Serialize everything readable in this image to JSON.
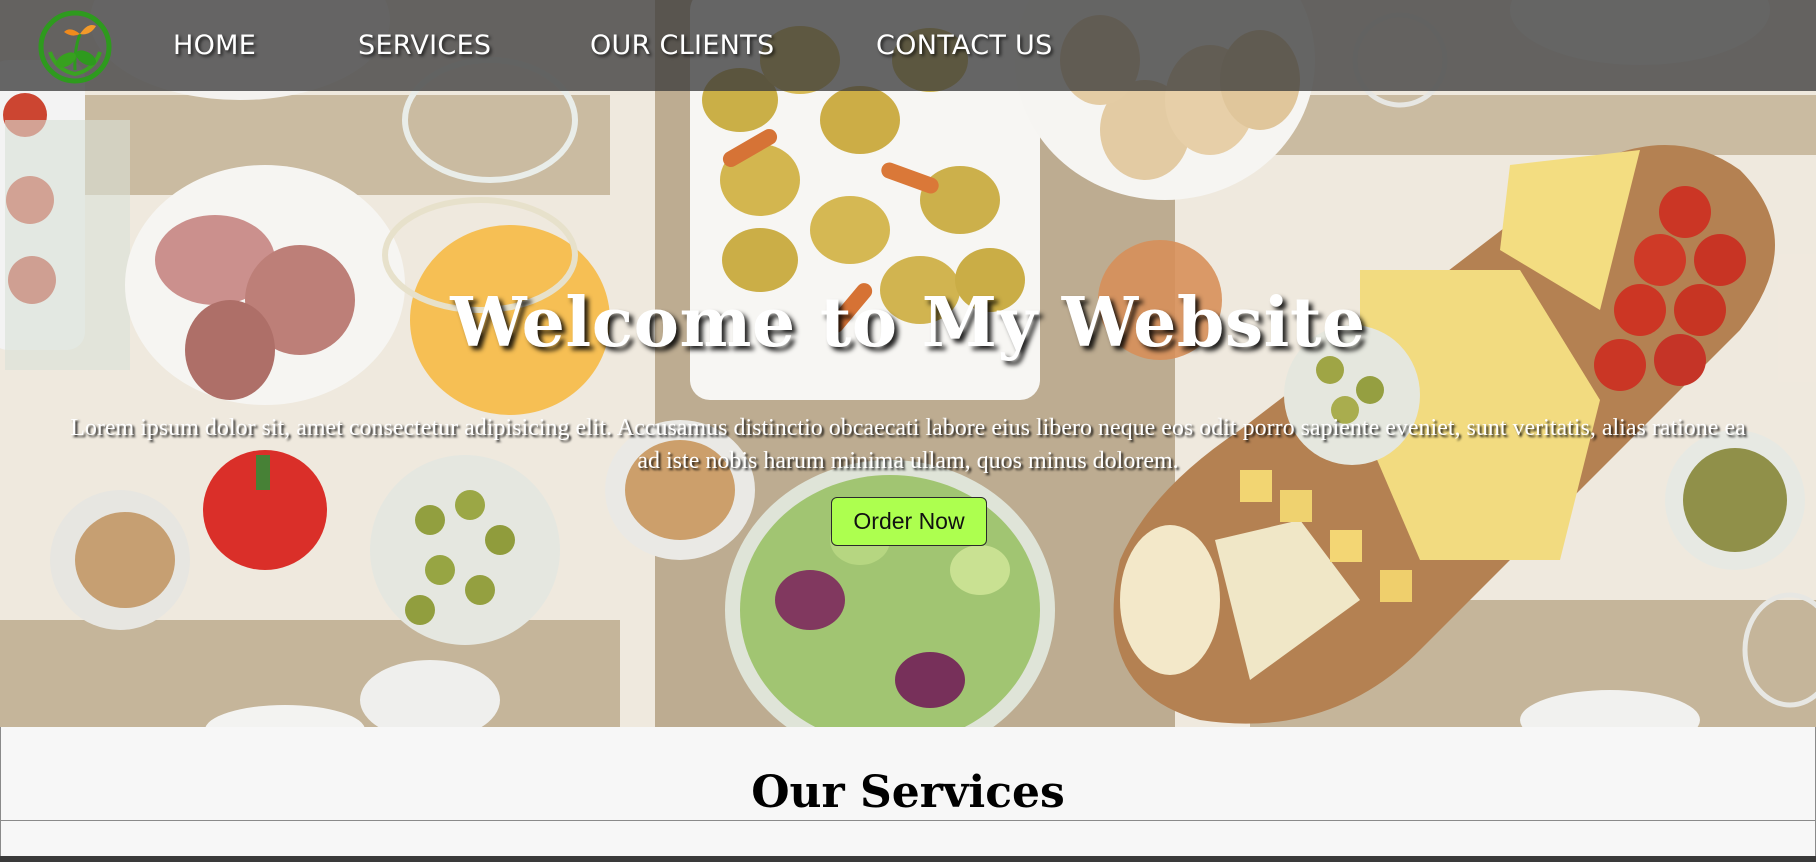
{
  "nav": {
    "logo_icon": "leaf-sprout-logo-icon",
    "items": [
      {
        "label": "HOME"
      },
      {
        "label": "SERVICES"
      },
      {
        "label": "OUR CLIENTS"
      },
      {
        "label": "CONTACT US"
      }
    ]
  },
  "hero": {
    "title": "Welcome to My Website",
    "text": "Lorem ipsum dolor sit, amet consectetur adipisicing elit. Accusamus distinctio obcaecati labore eius libero neque eos odit porro sapiente eveniet, sunt veritatis, alias ratione ea ad iste nobis harum minima ullam, quos minus dolorem.",
    "button_label": "Order Now",
    "background_image": "food-table-photo"
  },
  "services": {
    "title": "Our Services"
  },
  "colors": {
    "accent_button": "#adff4f",
    "logo_green": "#2e9a1e",
    "logo_orange": "#f08a1c",
    "nav_bg": "#3c3c3c"
  }
}
